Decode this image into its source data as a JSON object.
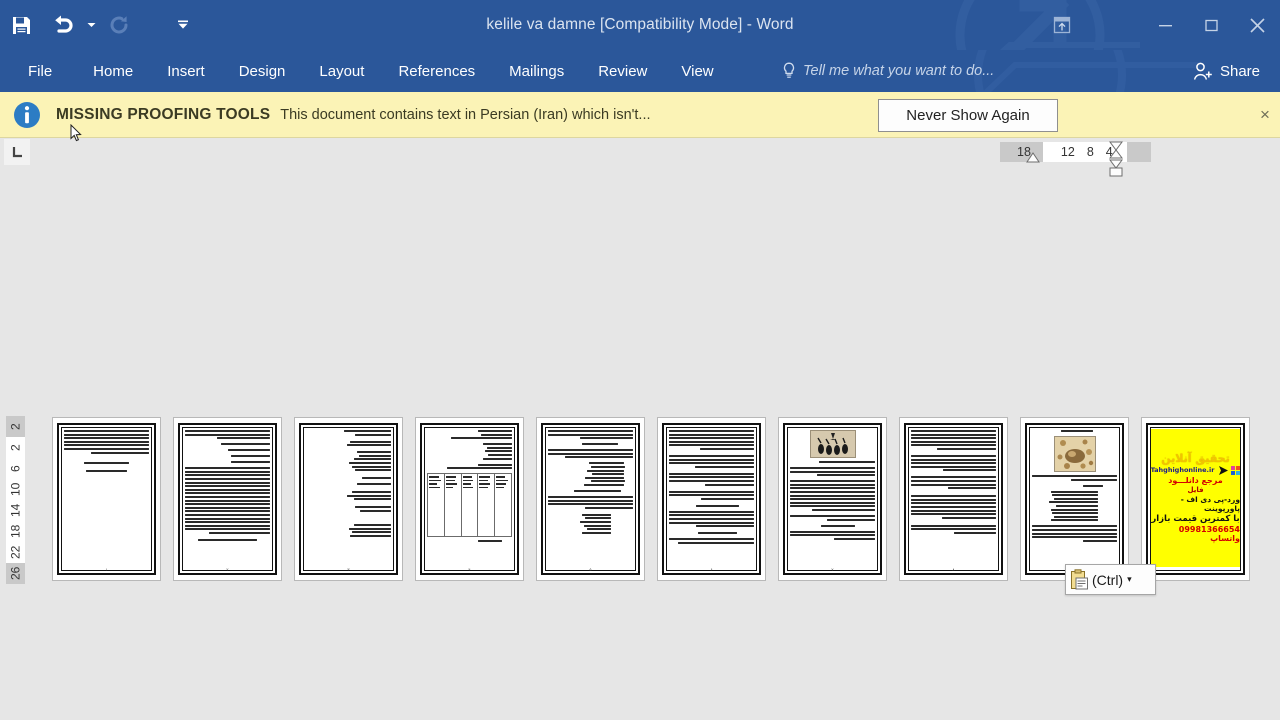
{
  "window": {
    "title": "kelile va damne [Compatibility Mode] - Word",
    "quick_access": [
      {
        "name": "save-button",
        "icon": "save-icon",
        "label": "Save"
      },
      {
        "name": "undo-button",
        "icon": "undo-icon",
        "label": "Undo"
      },
      {
        "name": "redo-button",
        "icon": "redo-icon",
        "label": "Redo"
      },
      {
        "name": "customize-qat-button",
        "icon": "chevron-down-icon",
        "label": "Customize Quick Access Toolbar"
      }
    ],
    "controls": [
      {
        "name": "ribbon-display-options-button",
        "icon": "ribbon-display-icon",
        "label": "Ribbon Display Options"
      },
      {
        "name": "minimize-button",
        "icon": "minimize-icon",
        "label": "Minimize"
      },
      {
        "name": "restore-button",
        "icon": "restore-icon",
        "label": "Restore Down"
      },
      {
        "name": "close-button",
        "icon": "close-icon",
        "label": "Close"
      }
    ]
  },
  "ribbon": {
    "tabs": [
      {
        "label": "File",
        "active": false
      },
      {
        "label": "Home",
        "active": false
      },
      {
        "label": "Insert",
        "active": false
      },
      {
        "label": "Design",
        "active": false
      },
      {
        "label": "Layout",
        "active": false
      },
      {
        "label": "References",
        "active": false
      },
      {
        "label": "Mailings",
        "active": false
      },
      {
        "label": "Review",
        "active": false
      },
      {
        "label": "View",
        "active": false
      }
    ],
    "tell_me_placeholder": "Tell me what you want to do...",
    "share_label": "Share"
  },
  "infobar": {
    "title": "MISSING PROOFING TOOLS",
    "message": "This document contains text in Persian (Iran) which isn't...",
    "button_label": "Never Show Again",
    "close_label": "×",
    "background_color": "#fbf3b6",
    "icon": "info-icon"
  },
  "rulers": {
    "tab_stop_label": "L",
    "horizontal_ticks": [
      "18",
      "12",
      "8",
      "4"
    ],
    "vertical_ticks": [
      "2",
      "2",
      "6",
      "10",
      "14",
      "18",
      "22",
      "26"
    ]
  },
  "paste_options": {
    "label": "(Ctrl)",
    "caret": "▾",
    "icon": "clipboard-icon"
  },
  "document": {
    "page_count": 10,
    "pages": [
      {
        "number": 1,
        "layout": "text-short",
        "page_label": "۱"
      },
      {
        "number": 2,
        "layout": "text-full",
        "page_label": "۲"
      },
      {
        "number": 3,
        "layout": "text-sparse",
        "page_label": "۳"
      },
      {
        "number": 4,
        "layout": "text-table",
        "page_label": "۴"
      },
      {
        "number": 5,
        "layout": "text-list",
        "page_label": "۵"
      },
      {
        "number": 6,
        "layout": "text-full",
        "page_label": "۶"
      },
      {
        "number": 7,
        "layout": "image-birds",
        "page_label": "۷"
      },
      {
        "number": 8,
        "layout": "text-full",
        "page_label": "۸"
      },
      {
        "number": 9,
        "layout": "image-painting",
        "page_label": "۹"
      },
      {
        "number": 10,
        "layout": "advertisement",
        "page_label": ""
      }
    ]
  },
  "advertisement": {
    "brand": "تحقیق آنلاین",
    "site": "Tahghighonline.ir",
    "line1": "مرجع دانلـــود",
    "line2": "فایل",
    "line3": "ورد-پی دی اف - پاورپوینت",
    "line4": "با کمترین قیمت بازار",
    "line5": "09981366654 واتساپ",
    "background_color": "#ffff00"
  },
  "colors": {
    "title_bar": "#2b579a",
    "workspace": "#e6e6e6",
    "infobar": "#fbf3b6",
    "page": "#ffffff"
  }
}
